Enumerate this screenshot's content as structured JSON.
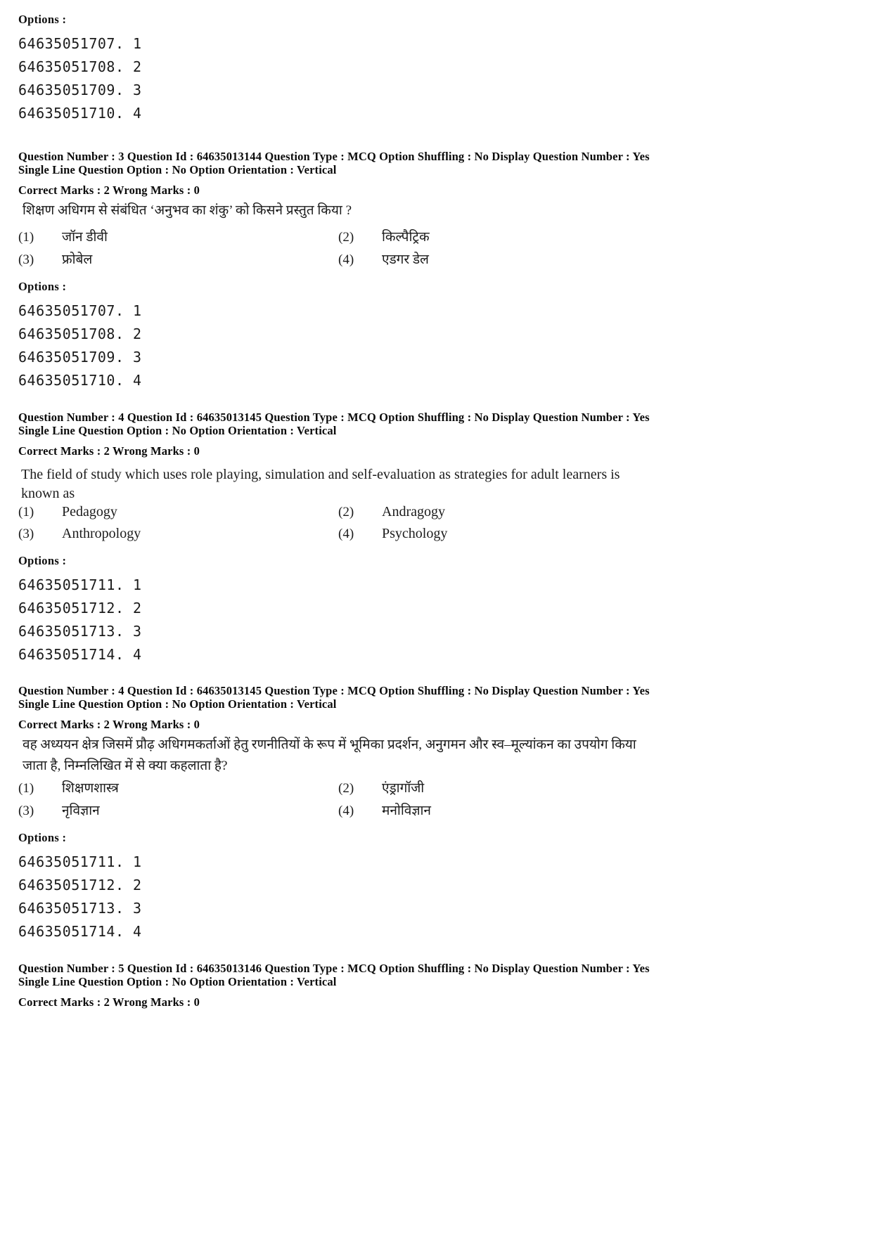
{
  "page": {
    "labels": {
      "options": "Options :"
    },
    "meta_template": {
      "question_number_label": "Question Number :",
      "question_id_label": "Question Id :",
      "question_type_label": "Question Type :",
      "option_shuffling_label": "Option Shuffling :",
      "display_question_number_label": "Display Question Number :",
      "single_line_label": "Single Line Question Option :",
      "option_orientation_label": "Option Orientation :",
      "correct_marks_label": "Correct Marks :",
      "wrong_marks_label": "Wrong Marks :"
    }
  },
  "blocks": [
    {
      "id": "top-options",
      "kind": "options-only",
      "options_label": "Options :",
      "option_ids": [
        "64635051707. 1",
        "64635051708. 2",
        "64635051709. 3",
        "64635051710. 4"
      ]
    },
    {
      "id": "q3-hindi",
      "kind": "question",
      "meta_line_1": "Question Number : 3  Question Id : 64635013144  Question Type : MCQ  Option Shuffling : No  Display Question Number : Yes",
      "meta_line_2": "Single Line Question Option : No  Option Orientation : Vertical",
      "marks_line": "Correct Marks : 2  Wrong Marks : 0",
      "language": "hi",
      "question_text": "शिक्षण अधिगम से संबंधित ‘अनुभव का शंकु’ को किसने प्रस्तुत किया ?",
      "choices": [
        {
          "num": "(1)",
          "text": "जॉन डीवी"
        },
        {
          "num": "(2)",
          "text": "किल्पैट्रिक"
        },
        {
          "num": "(3)",
          "text": "फ्रोबेल"
        },
        {
          "num": "(4)",
          "text": "एडगर डेल"
        }
      ],
      "options_label": "Options :",
      "option_ids": [
        "64635051707. 1",
        "64635051708. 2",
        "64635051709. 3",
        "64635051710. 4"
      ]
    },
    {
      "id": "q4-english",
      "kind": "question",
      "meta_line_1": "Question Number : 4  Question Id : 64635013145  Question Type : MCQ  Option Shuffling : No  Display Question Number : Yes",
      "meta_line_2": "Single Line Question Option : No  Option Orientation : Vertical",
      "marks_line": "Correct Marks : 2  Wrong Marks : 0",
      "language": "en",
      "question_text": "The field of study which uses role playing, simulation and self-evaluation as strategies for adult learners is known as",
      "choices": [
        {
          "num": "(1)",
          "text": "Pedagogy"
        },
        {
          "num": "(2)",
          "text": "Andragogy"
        },
        {
          "num": "(3)",
          "text": "Anthropology"
        },
        {
          "num": "(4)",
          "text": "Psychology"
        }
      ],
      "options_label": "Options :",
      "option_ids": [
        "64635051711. 1",
        "64635051712. 2",
        "64635051713. 3",
        "64635051714. 4"
      ]
    },
    {
      "id": "q4-hindi",
      "kind": "question",
      "meta_line_1": "Question Number : 4  Question Id : 64635013145  Question Type : MCQ  Option Shuffling : No  Display Question Number : Yes",
      "meta_line_2": "Single Line Question Option : No  Option Orientation : Vertical",
      "marks_line": "Correct Marks : 2  Wrong Marks : 0",
      "language": "hi",
      "question_text": "वह अध्ययन क्षेत्र जिसमें प्रौढ़ अधिगमकर्ताओं हेतु रणनीतियों के रूप में भूमिका प्रदर्शन, अनुगमन और स्व–मूल्यांकन का उपयोग किया जाता है, निम्नलिखित में से क्या कहलाता है?",
      "choices": [
        {
          "num": "(1)",
          "text": "शिक्षणशास्त्र"
        },
        {
          "num": "(2)",
          "text": "एंड्रागॉजी"
        },
        {
          "num": "(3)",
          "text": "नृविज्ञान"
        },
        {
          "num": "(4)",
          "text": "मनोविज्ञान"
        }
      ],
      "options_label": "Options :",
      "option_ids": [
        "64635051711. 1",
        "64635051712. 2",
        "64635051713. 3",
        "64635051714. 4"
      ]
    },
    {
      "id": "q5-header",
      "kind": "header-only",
      "meta_line_1": "Question Number : 5  Question Id : 64635013146  Question Type : MCQ  Option Shuffling : No  Display Question Number : Yes",
      "meta_line_2": "Single Line Question Option : No  Option Orientation : Vertical",
      "marks_line": "Correct Marks : 2  Wrong Marks : 0"
    }
  ]
}
